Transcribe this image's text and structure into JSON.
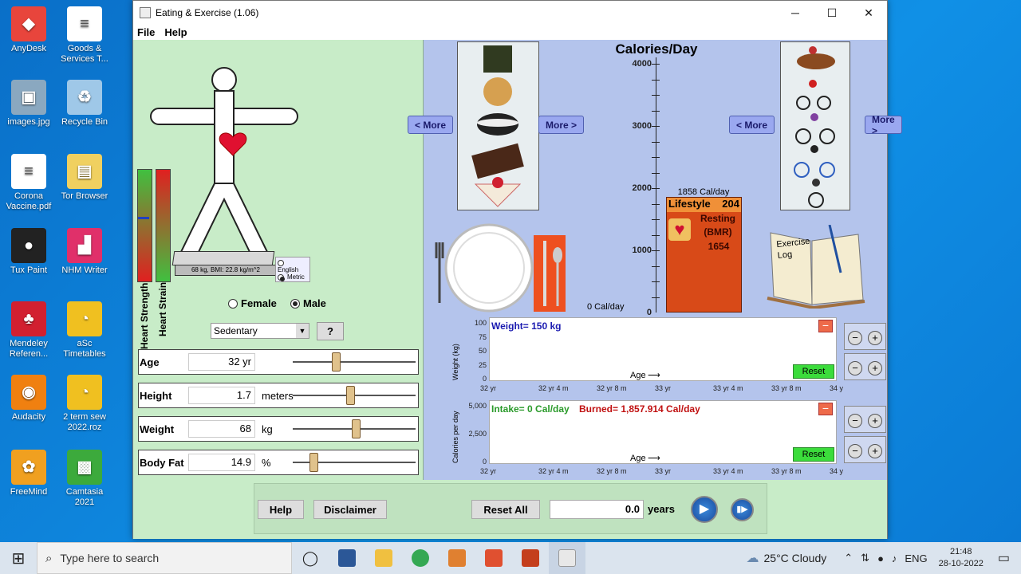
{
  "desktop": {
    "icons": [
      {
        "label": "AnyDesk",
        "color": "#e8453c",
        "glyph": "◆"
      },
      {
        "label": "images.jpg",
        "color": "#8aa8c0",
        "glyph": "▣"
      },
      {
        "label": "Corona Vaccine.pdf",
        "color": "#ffffff",
        "glyph": "≡"
      },
      {
        "label": "Tux Paint",
        "color": "#222222",
        "glyph": "●"
      },
      {
        "label": "Mendeley Referen...",
        "color": "#d22030",
        "glyph": "♣"
      },
      {
        "label": "Audacity",
        "color": "#f08010",
        "glyph": "◉"
      },
      {
        "label": "FreeMind",
        "color": "#f0a020",
        "glyph": "✿"
      },
      {
        "label": "Goods & Services T...",
        "color": "#ffffff",
        "glyph": "≡"
      },
      {
        "label": "Recycle Bin",
        "color": "#9fc8e8",
        "glyph": "♻"
      },
      {
        "label": "Tor Browser",
        "color": "#f0d060",
        "glyph": "▤"
      },
      {
        "label": "NHM Writer",
        "color": "#e0306a",
        "glyph": "▟"
      },
      {
        "label": "aSc Timetables",
        "color": "#f0c020",
        "glyph": "◔"
      },
      {
        "label": "2 term sew 2022.roz",
        "color": "#f0c020",
        "glyph": "◔"
      },
      {
        "label": "Camtasia 2021",
        "color": "#3caa3c",
        "glyph": "▩"
      }
    ]
  },
  "window": {
    "title": "Eating & Exercise (1.06)",
    "menu": [
      "File",
      "Help"
    ]
  },
  "left": {
    "heart_strength": "Heart Strength",
    "heart_strain": "Heart Strain",
    "scale_text": "68 kg, BMI: 22.8 kg/m^2",
    "units": [
      "English",
      "Metric"
    ],
    "units_selected": "Metric",
    "gender": {
      "female": "Female",
      "male": "Male",
      "selected": "Male"
    },
    "lifestyle": "Sedentary",
    "help_btn": "?",
    "sliders": [
      {
        "label": "Age",
        "value": "32 yr",
        "unit": "",
        "pos": 0.33
      },
      {
        "label": "Height",
        "value": "1.7",
        "unit": "meters",
        "pos": 0.45
      },
      {
        "label": "Weight",
        "value": "68",
        "unit": "kg",
        "pos": 0.5
      },
      {
        "label": "Body Fat",
        "value": "14.9",
        "unit": "%",
        "pos": 0.14
      }
    ]
  },
  "right": {
    "title": "Calories/Day",
    "more": "More >",
    "less": "< More",
    "axis": [
      "4000",
      "3000",
      "2000",
      "1000",
      "0"
    ],
    "intake_label": "0 Cal/day",
    "burn_total": "1858 Cal/day",
    "lifestyle_label": "Lifestyle",
    "lifestyle_val": "204",
    "resting_label": "Resting (BMR)",
    "resting_val": "1654",
    "exercise_log": "Exercise Log",
    "weight_graph": {
      "title": "Weight= 150 kg",
      "ylabel": "Weight (kg)",
      "yticks": [
        "100",
        "75",
        "50",
        "25",
        "0"
      ],
      "xlabel": "Age",
      "xticks": [
        "32 yr",
        "32 yr 4 m",
        "32 yr 8 m",
        "33 yr",
        "33 yr 4 m",
        "33 yr 8 m",
        "34 y"
      ],
      "reset": "Reset"
    },
    "cal_graph": {
      "intake": "Intake= 0 Cal/day",
      "burned": "Burned= 1,857.914 Cal/day",
      "ylabel": "Calories per day",
      "yticks": [
        "5,000",
        "2,500",
        "0"
      ],
      "xlabel": "Age",
      "xticks": [
        "32 yr",
        "32 yr 4 m",
        "32 yr 8 m",
        "33 yr",
        "33 yr 4 m",
        "33 yr 8 m",
        "34 y"
      ],
      "reset": "Reset"
    }
  },
  "bottom": {
    "help": "Help",
    "disclaimer": "Disclaimer",
    "reset_all": "Reset All",
    "time": "0.0",
    "time_unit": "years"
  },
  "taskbar": {
    "search": "Type here to search",
    "weather": "25°C  Cloudy",
    "lang": "ENG",
    "time": "21:48",
    "date": "28-10-2022"
  }
}
